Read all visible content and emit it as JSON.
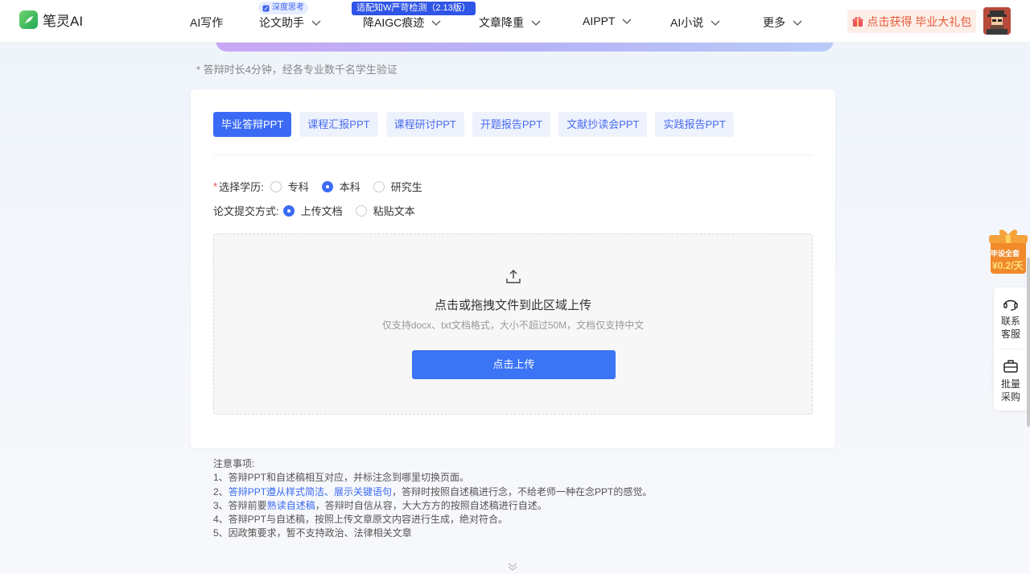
{
  "header": {
    "logo_text": "笔灵AI",
    "nav": [
      {
        "label": "AI写作"
      },
      {
        "label": "论文助手"
      },
      {
        "label": "降AIGC痕迹"
      },
      {
        "label": "文章降重"
      },
      {
        "label": "AIPPT"
      },
      {
        "label": "AI小说"
      },
      {
        "label": "更多"
      }
    ],
    "badge_deep": "深度思考",
    "badge_aigc": "适配知W严苛检测（2.13版）",
    "gift_label": "点击获得 毕业大礼包"
  },
  "page": {
    "top_note": "* 答辩时长4分钟，经各专业数千名学生验证"
  },
  "card": {
    "tabs": [
      {
        "label": "毕业答辩PPT",
        "active": true
      },
      {
        "label": "课程汇报PPT",
        "active": false
      },
      {
        "label": "课程研讨PPT",
        "active": false
      },
      {
        "label": "开题报告PPT",
        "active": false
      },
      {
        "label": "文献抄读会PPT",
        "active": false
      },
      {
        "label": "实践报告PPT",
        "active": false
      }
    ],
    "degree_label": "选择学历:",
    "degree_options": [
      {
        "label": "专科",
        "selected": false
      },
      {
        "label": "本科",
        "selected": true
      },
      {
        "label": "研究生",
        "selected": false
      }
    ],
    "submit_label": "论文提交方式:",
    "submit_options": [
      {
        "label": "上传文档",
        "selected": true
      },
      {
        "label": "粘贴文本",
        "selected": false
      }
    ],
    "upload": {
      "title": "点击或拖拽文件到此区域上传",
      "subtitle": "仅支持docx、txt文档格式，大小不超过50M，文档仅支持中文",
      "button": "点击上传"
    }
  },
  "notes": {
    "heading": "注意事项:",
    "line1": "1、答辩PPT和自述稿相互对应，并标注念到哪里切换页面。",
    "line2_prefix": "2、",
    "line2_highlight": "答辩PPT遵从样式简洁、展示关键语句",
    "line2_rest": "，答辩时按照自述稿进行念，不给老师一种在念PPT的感觉。",
    "line3_prefix": "3、答辩前要",
    "line3_highlight": "熟读自述稿",
    "line3_rest": "，答辩时自信从容，大大方方的按照自述稿进行自述。",
    "line4": "4、答辩PPT与自述稿，按照上传文章原文内容进行生成，绝对符合。",
    "line5": "5、因政策要求，暂不支持政治、法律相关文章"
  },
  "side": {
    "promo_line1": "毕设全套",
    "promo_line2": "¥0.2/天",
    "service_l1": "联系",
    "service_l2": "客服",
    "bulk_l1": "批量",
    "bulk_l2": "采购"
  },
  "colors": {
    "primary": "#3b6bf5",
    "gift_text": "#e65a3a",
    "required": "#e54545"
  }
}
